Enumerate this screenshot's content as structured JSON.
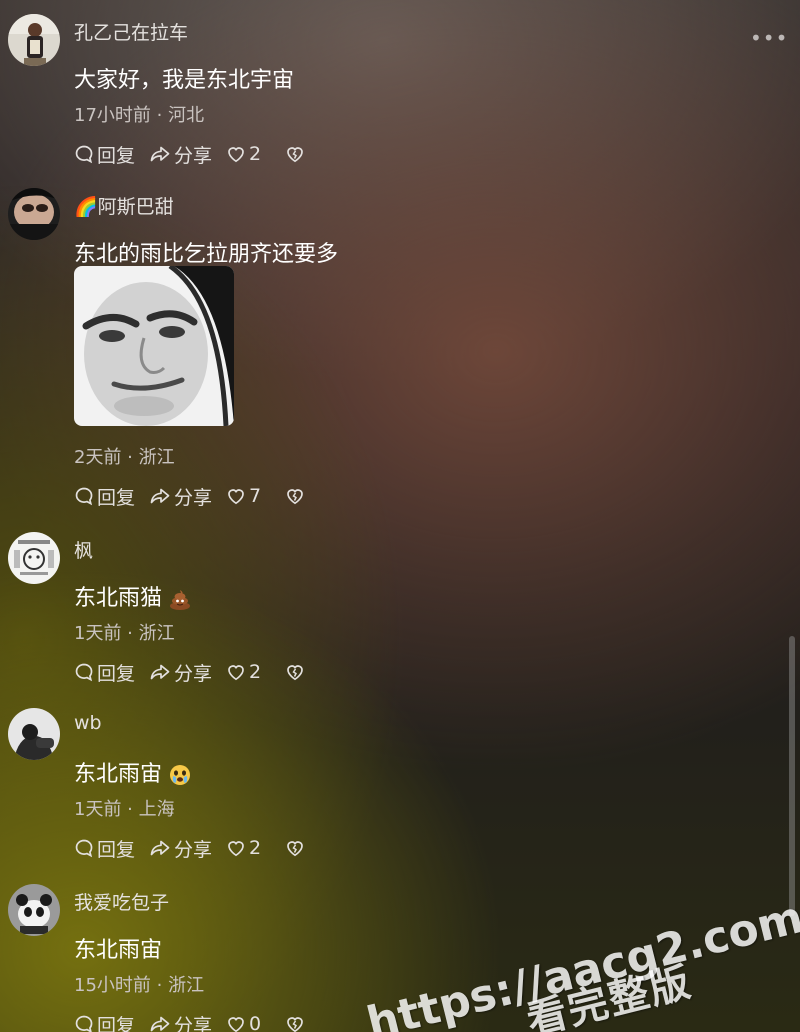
{
  "header": {
    "more_icon": "more-dots-icon",
    "more_label": "•••"
  },
  "actions_text": {
    "reply_label": "回复",
    "share_label": "分享"
  },
  "comments": [
    {
      "username": "孔乙己在拉车",
      "text": "大家好，我是东北宇宙",
      "meta": "17小时前 · 河北",
      "likes": "2"
    },
    {
      "username": "🌈阿斯巴甜",
      "text": "东北的雨比乞拉朋齐还要多",
      "has_sticker": true,
      "meta": "2天前 · 浙江",
      "likes": "7"
    },
    {
      "username": "枫",
      "text": "东北雨猫",
      "emoji": "poop-emoji",
      "meta": "1天前 · 浙江",
      "likes": "2"
    },
    {
      "username": "wb",
      "text": "东北雨宙",
      "emoji": "crying-face-emoji",
      "meta": "1天前 · 上海",
      "likes": "2"
    },
    {
      "username": "我爱吃包子",
      "text": "东北雨宙",
      "meta": "15小时前 · 浙江",
      "likes": "0"
    }
  ],
  "watermark": {
    "url": "https://aacg2.com",
    "subtitle": "看完整版"
  },
  "colors": {
    "text_primary": "#ffffff",
    "text_secondary": "#c9c3c0",
    "accent_yellow": "#7a7410",
    "accent_brown": "#704a3a"
  }
}
